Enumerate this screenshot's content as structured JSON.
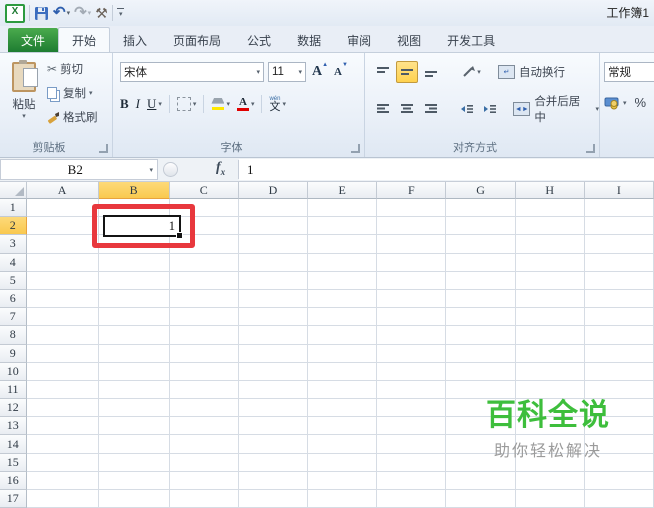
{
  "window": {
    "title": "工作簿1"
  },
  "icons": {
    "excel_logo": "X",
    "undo": "↶",
    "redo": "↷",
    "customize_tools": "⚒",
    "cut": "✂",
    "dropdown": "▾",
    "name_box_dropdown": "▾",
    "wrap_arrow": "↵",
    "merge_arrows": "◄►",
    "grow_caret": "▲",
    "shrink_caret": "▼"
  },
  "tabs": [
    {
      "label": "文件"
    },
    {
      "label": "开始",
      "active": true
    },
    {
      "label": "插入"
    },
    {
      "label": "页面布局"
    },
    {
      "label": "公式"
    },
    {
      "label": "数据"
    },
    {
      "label": "审阅"
    },
    {
      "label": "视图"
    },
    {
      "label": "开发工具"
    }
  ],
  "ribbon": {
    "clipboard": {
      "label": "剪贴板",
      "paste": "粘贴",
      "cut": "剪切",
      "copy": "复制",
      "format_painter": "格式刷"
    },
    "font": {
      "label": "字体",
      "name": "宋体",
      "size": "11",
      "bold": "B",
      "italic": "I",
      "underline": "U",
      "grow": "A",
      "shrink": "A",
      "color_letter": "A",
      "phonetic": "文",
      "phonetic_hint": "wén",
      "fill_color": "#ffe800",
      "font_color": "#e00000"
    },
    "alignment": {
      "label": "对齐方式",
      "wrap": "自动换行",
      "merge": "合并后居中"
    },
    "number": {
      "format": "常规",
      "percent": "%"
    }
  },
  "formula_bar": {
    "name_box": "B2",
    "fx": "f",
    "fx_sub": "x",
    "value": "1"
  },
  "sheet": {
    "columns": [
      "A",
      "B",
      "C",
      "D",
      "E",
      "F",
      "G",
      "H",
      "I"
    ],
    "rows": [
      "1",
      "2",
      "3",
      "4",
      "5",
      "6",
      "7",
      "8",
      "9",
      "10",
      "11",
      "12",
      "13",
      "14",
      "15",
      "16",
      "17"
    ],
    "active_cell": {
      "ref": "B2",
      "value": "1",
      "column": "B",
      "row": "2"
    }
  },
  "annotation": {
    "shape": "red-rectangle",
    "color": "#e8383d"
  },
  "watermark": {
    "title": "百科全说",
    "subtitle": "助你轻松解决",
    "title_color": "#3ebe3c",
    "subtitle_color": "#9b9b9b"
  }
}
